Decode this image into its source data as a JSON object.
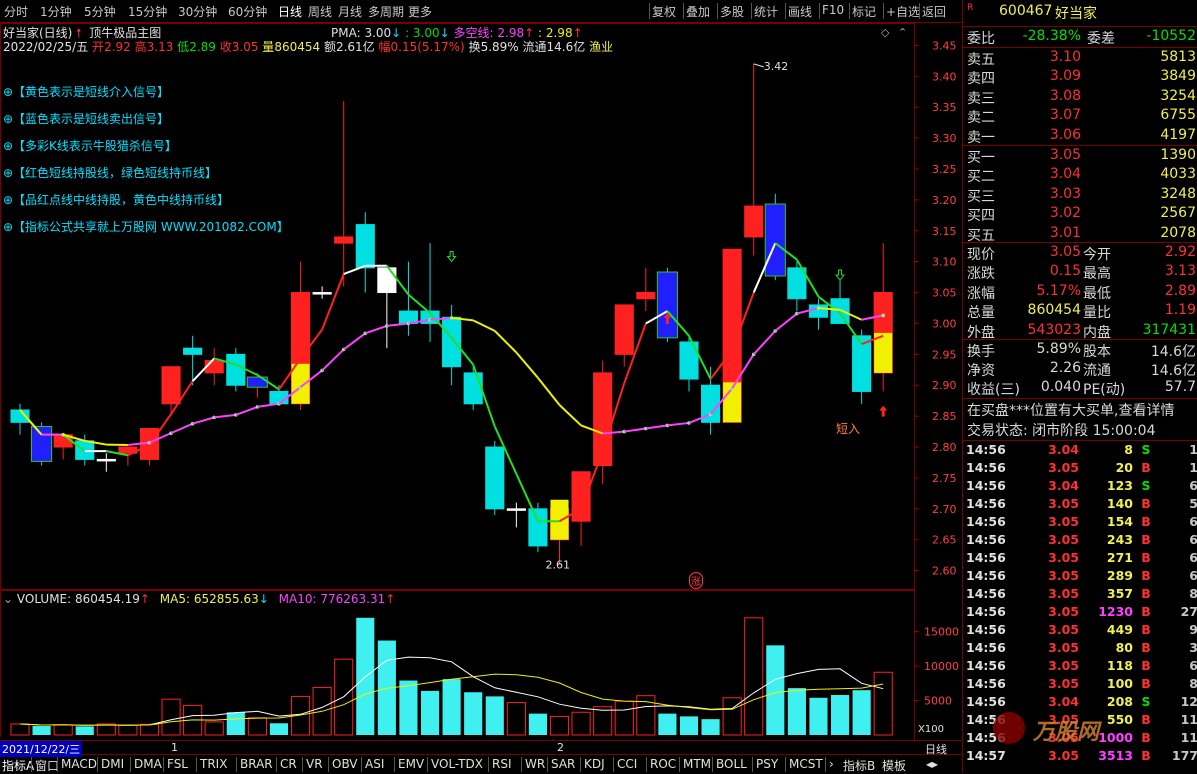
{
  "toolbar": {
    "periods": [
      "分时",
      "1分钟",
      "5分钟",
      "15分钟",
      "30分钟",
      "60分钟",
      "日线",
      "周线",
      "月线",
      "多周期",
      "更多"
    ],
    "active_period": "日线",
    "tools": [
      "复权",
      "叠加",
      "多股",
      "统计",
      "画线",
      "F10",
      "标记",
      "+自选",
      "返回"
    ]
  },
  "chart": {
    "header": "好当家(日线)",
    "indicator": "顶牛极品主图",
    "date_line": "2022/02/25/五",
    "open_label": "开",
    "open": "2.92",
    "high_label": "高",
    "high": "3.13",
    "low_label": "低",
    "low": "2.89",
    "close_label": "收",
    "close": "3.05",
    "vol_label": "量",
    "vol": "860454",
    "amount": "额2.61亿",
    "amp_label": "幅",
    "amp": "0.15(5.17%)",
    "turnover": "换5.89%",
    "float": "流通14.6亿",
    "sector": "渔业",
    "pma_label": "PMA: 3.00",
    "pma2": ": 3.00",
    "dk_label": "多空线: 2.98",
    "dk2": ": 2.98",
    "signals": [
      "⊕【黄色表示是短线介入信号】",
      "⊕【蓝色表示是短线卖出信号】",
      "⊕【多彩K线表示牛股猎杀信号】",
      "⊕【红色短线持股线，绿色短线持币线】",
      "⊕【品红点线中线持股，黄色中线持币线】",
      "⊕【指标公式共享就上万股网 WWW.201082.COM】"
    ],
    "price_axis": [
      "3.45",
      "3.40",
      "3.35",
      "3.30",
      "3.25",
      "3.20",
      "3.15",
      "3.10",
      "3.05",
      "3.00",
      "2.95",
      "2.90",
      "2.85",
      "2.80",
      "2.75",
      "2.70",
      "2.65",
      "2.60"
    ],
    "hi_mark": "3.42",
    "lo_mark": "2.61",
    "short_in": "短入",
    "zhang": "涨"
  },
  "chart_data": {
    "type": "candlestick",
    "ylim": [
      2.58,
      3.47
    ],
    "candles": [
      {
        "o": 2.84,
        "h": 2.87,
        "l": 2.82,
        "c": 2.86,
        "style": "cyan"
      },
      {
        "o": 2.83,
        "h": 2.84,
        "l": 2.77,
        "c": 2.78,
        "style": "cyan"
      },
      {
        "o": 2.8,
        "h": 2.81,
        "l": 2.78,
        "c": 2.82,
        "style": "red"
      },
      {
        "o": 2.81,
        "h": 2.82,
        "l": 2.77,
        "c": 2.78,
        "style": "cyan"
      },
      {
        "o": 2.78,
        "h": 2.79,
        "l": 2.76,
        "c": 2.78,
        "style": "white"
      },
      {
        "o": 2.79,
        "h": 2.8,
        "l": 2.77,
        "c": 2.8,
        "style": "red"
      },
      {
        "o": 2.78,
        "h": 2.82,
        "l": 2.77,
        "c": 2.83,
        "style": "red"
      },
      {
        "o": 2.87,
        "h": 2.93,
        "l": 2.85,
        "c": 2.93,
        "style": "red"
      },
      {
        "o": 2.95,
        "h": 2.98,
        "l": 2.9,
        "c": 2.96,
        "style": "cyan"
      },
      {
        "o": 2.92,
        "h": 2.96,
        "l": 2.9,
        "c": 2.94,
        "style": "red"
      },
      {
        "o": 2.95,
        "h": 2.96,
        "l": 2.89,
        "c": 2.9,
        "style": "cyan"
      },
      {
        "o": 2.9,
        "h": 2.92,
        "l": 2.88,
        "c": 2.91,
        "style": "red"
      },
      {
        "o": 2.89,
        "h": 2.9,
        "l": 2.87,
        "c": 2.87,
        "style": "cyan"
      },
      {
        "o": 2.87,
        "h": 3.1,
        "l": 2.86,
        "c": 3.05,
        "style": "red"
      },
      {
        "o": 3.05,
        "h": 3.06,
        "l": 3.04,
        "c": 3.05,
        "style": "white"
      },
      {
        "o": 3.13,
        "h": 3.36,
        "l": 3.06,
        "c": 3.14,
        "style": "red"
      },
      {
        "o": 3.16,
        "h": 3.18,
        "l": 3.05,
        "c": 3.09,
        "style": "cyan"
      },
      {
        "o": 3.09,
        "h": 3.09,
        "l": 2.96,
        "c": 3.05,
        "style": "white"
      },
      {
        "o": 3.02,
        "h": 3.1,
        "l": 2.98,
        "c": 3.0,
        "style": "cyan"
      },
      {
        "o": 3.02,
        "h": 3.13,
        "l": 2.97,
        "c": 3.0,
        "style": "cyan"
      },
      {
        "o": 3.01,
        "h": 3.03,
        "l": 2.9,
        "c": 2.93,
        "style": "cyan"
      },
      {
        "o": 2.92,
        "h": 2.93,
        "l": 2.86,
        "c": 2.87,
        "style": "cyan"
      },
      {
        "o": 2.8,
        "h": 2.81,
        "l": 2.69,
        "c": 2.7,
        "style": "cyan"
      },
      {
        "o": 2.7,
        "h": 2.71,
        "l": 2.67,
        "c": 2.7,
        "style": "white"
      },
      {
        "o": 2.7,
        "h": 2.71,
        "l": 2.63,
        "c": 2.64,
        "style": "cyan"
      },
      {
        "o": 2.65,
        "h": 2.7,
        "l": 2.61,
        "c": 2.7,
        "style": "red"
      },
      {
        "o": 2.68,
        "h": 2.75,
        "l": 2.64,
        "c": 2.76,
        "style": "red"
      },
      {
        "o": 2.77,
        "h": 2.94,
        "l": 2.74,
        "c": 2.92,
        "style": "red"
      },
      {
        "o": 2.95,
        "h": 3.02,
        "l": 2.93,
        "c": 3.03,
        "style": "red"
      },
      {
        "o": 3.04,
        "h": 3.09,
        "l": 3.02,
        "c": 3.05,
        "style": "red"
      },
      {
        "o": 3.08,
        "h": 3.09,
        "l": 2.97,
        "c": 2.98,
        "style": "cyan"
      },
      {
        "o": 2.97,
        "h": 2.98,
        "l": 2.89,
        "c": 2.91,
        "style": "cyan"
      },
      {
        "o": 2.9,
        "h": 2.93,
        "l": 2.82,
        "c": 2.84,
        "style": "cyan"
      },
      {
        "o": 2.84,
        "h": 3.12,
        "l": 2.84,
        "c": 3.12,
        "style": "red"
      },
      {
        "o": 3.14,
        "h": 3.42,
        "l": 3.11,
        "c": 3.19,
        "style": "red"
      },
      {
        "o": 3.19,
        "h": 3.21,
        "l": 3.07,
        "c": 3.08,
        "style": "cyan"
      },
      {
        "o": 3.09,
        "h": 3.1,
        "l": 3.02,
        "c": 3.04,
        "style": "cyan"
      },
      {
        "o": 3.03,
        "h": 3.04,
        "l": 2.99,
        "c": 3.01,
        "style": "cyan"
      },
      {
        "o": 3.04,
        "h": 3.07,
        "l": 3.02,
        "c": 3.0,
        "style": "cyan"
      },
      {
        "o": 2.98,
        "h": 2.99,
        "l": 2.87,
        "c": 2.89,
        "style": "cyan"
      },
      {
        "o": 2.92,
        "h": 3.13,
        "l": 2.89,
        "c": 3.05,
        "style": "red"
      }
    ],
    "volume": [
      1600,
      1300,
      1500,
      1250,
      1600,
      1400,
      1550,
      5200,
      4300,
      1900,
      3300,
      2500,
      1700,
      5600,
      6900,
      11000,
      17000,
      13700,
      7900,
      6400,
      8100,
      6200,
      5600,
      4700,
      3100,
      2700,
      3300,
      4100,
      4900,
      5700,
      3100,
      2700,
      2300,
      5400,
      17000,
      13000,
      6800,
      5400,
      5800,
      6500,
      9100
    ],
    "vol_axis": [
      "15000",
      "10000",
      "5000"
    ],
    "volume_label": "VOLUME: 860454.19",
    "ma5_label": "MA5: 652855.63",
    "ma10_label": "MA10: 776263.31",
    "x_unit": "X100",
    "period_label": "日线",
    "x_start": "2021/12/22/三",
    "x_month_marks": [
      "1",
      "2"
    ]
  },
  "quote": {
    "code": "600467",
    "name": "好当家",
    "wb_label": "委比",
    "wb_value": "-28.38%",
    "wc_label": "委差",
    "wc_value": "-10552",
    "sells": [
      {
        "label": "卖五",
        "price": "3.10",
        "vol": "5813"
      },
      {
        "label": "卖四",
        "price": "3.09",
        "vol": "3849"
      },
      {
        "label": "卖三",
        "price": "3.08",
        "vol": "3254"
      },
      {
        "label": "卖二",
        "price": "3.07",
        "vol": "6755"
      },
      {
        "label": "卖一",
        "price": "3.06",
        "vol": "4197"
      }
    ],
    "buys": [
      {
        "label": "买一",
        "price": "3.05",
        "vol": "1390"
      },
      {
        "label": "买二",
        "price": "3.04",
        "vol": "4033"
      },
      {
        "label": "买三",
        "price": "3.03",
        "vol": "3248"
      },
      {
        "label": "买四",
        "price": "3.02",
        "vol": "2567"
      },
      {
        "label": "买五",
        "price": "3.01",
        "vol": "2078"
      }
    ],
    "stats": [
      {
        "l1": "现价",
        "v1": "3.05",
        "c1": "#ff3030",
        "l2": "今开",
        "v2": "2.92",
        "c2": "#ff3030"
      },
      {
        "l1": "涨跌",
        "v1": "0.15",
        "c1": "#ff3030",
        "l2": "最高",
        "v2": "3.13",
        "c2": "#ff3030"
      },
      {
        "l1": "涨幅",
        "v1": "5.17%",
        "c1": "#ff3030",
        "l2": "最低",
        "v2": "2.89",
        "c2": "#ff3030"
      },
      {
        "l1": "总量",
        "v1": "860454",
        "c1": "#f0f050",
        "l2": "量比",
        "v2": "1.19",
        "c2": "#ff3030"
      },
      {
        "l1": "外盘",
        "v1": "543023",
        "c1": "#ff3030",
        "l2": "内盘",
        "v2": "317431",
        "c2": "#00e000"
      }
    ],
    "stats2": [
      {
        "l1": "换手",
        "v1": "5.89%",
        "l2": "股本",
        "v2": "14.6亿"
      },
      {
        "l1": "净资",
        "v1": "2.26",
        "l2": "流通",
        "v2": "14.6亿"
      },
      {
        "l1": "收益(三)",
        "v1": "0.040",
        "l2": "PE(动)",
        "v2": "57.7"
      }
    ],
    "notice": "在买盘***位置有大买单,查看详情",
    "trade_state": "交易状态: 闭市阶段 15:00:04",
    "ticks": [
      {
        "t": "14:56",
        "p": "3.04",
        "v": "8",
        "d": "S",
        "n": "1"
      },
      {
        "t": "14:56",
        "p": "3.05",
        "v": "20",
        "d": "B",
        "n": "1"
      },
      {
        "t": "14:56",
        "p": "3.04",
        "v": "123",
        "d": "S",
        "n": "6"
      },
      {
        "t": "14:56",
        "p": "3.05",
        "v": "140",
        "d": "B",
        "n": "5"
      },
      {
        "t": "14:56",
        "p": "3.05",
        "v": "154",
        "d": "B",
        "n": "6"
      },
      {
        "t": "14:56",
        "p": "3.05",
        "v": "243",
        "d": "B",
        "n": "6"
      },
      {
        "t": "14:56",
        "p": "3.05",
        "v": "271",
        "d": "B",
        "n": "6"
      },
      {
        "t": "14:56",
        "p": "3.05",
        "v": "289",
        "d": "B",
        "n": "6"
      },
      {
        "t": "14:56",
        "p": "3.05",
        "v": "357",
        "d": "B",
        "n": "8"
      },
      {
        "t": "14:56",
        "p": "3.05",
        "v": "1230",
        "d": "B",
        "n": "27"
      },
      {
        "t": "14:56",
        "p": "3.05",
        "v": "449",
        "d": "B",
        "n": "9"
      },
      {
        "t": "14:56",
        "p": "3.05",
        "v": "80",
        "d": "B",
        "n": "3"
      },
      {
        "t": "14:56",
        "p": "3.05",
        "v": "118",
        "d": "B",
        "n": "6"
      },
      {
        "t": "14:56",
        "p": "3.05",
        "v": "100",
        "d": "B",
        "n": "8"
      },
      {
        "t": "14:56",
        "p": "3.04",
        "v": "208",
        "d": "S",
        "n": "12"
      },
      {
        "t": "14:56",
        "p": "3.05",
        "v": "550",
        "d": "B",
        "n": "11"
      },
      {
        "t": "14:56",
        "p": "3.05",
        "v": "1000",
        "d": "B",
        "n": "11"
      },
      {
        "t": "14:57",
        "p": "3.05",
        "v": "3513",
        "d": "B",
        "n": "177"
      }
    ],
    "watermark": "万股网 www.201082.com"
  },
  "tabs": [
    "指标A",
    "窗口",
    "MACD",
    "DMI",
    "DMA",
    "FSL",
    "TRIX",
    "BRAR",
    "CR",
    "VR",
    "OBV",
    "ASI",
    "EMV",
    "VOL-TDX",
    "RSI",
    "WR",
    "SAR",
    "KDJ",
    "CCI",
    "ROC",
    "MTM",
    "BOLL",
    "PSY",
    "MCST"
  ],
  "tabs_right": [
    "指标B",
    "模板"
  ],
  "colors": {
    "up": "#ff2020",
    "down": "#00e0e0",
    "bg": "#000000",
    "border": "#7a0000",
    "ma_short": "#ff2020",
    "ma_mid": "#ff40ff",
    "ma_yellow": "#f0f000",
    "ma_green": "#20e020"
  }
}
